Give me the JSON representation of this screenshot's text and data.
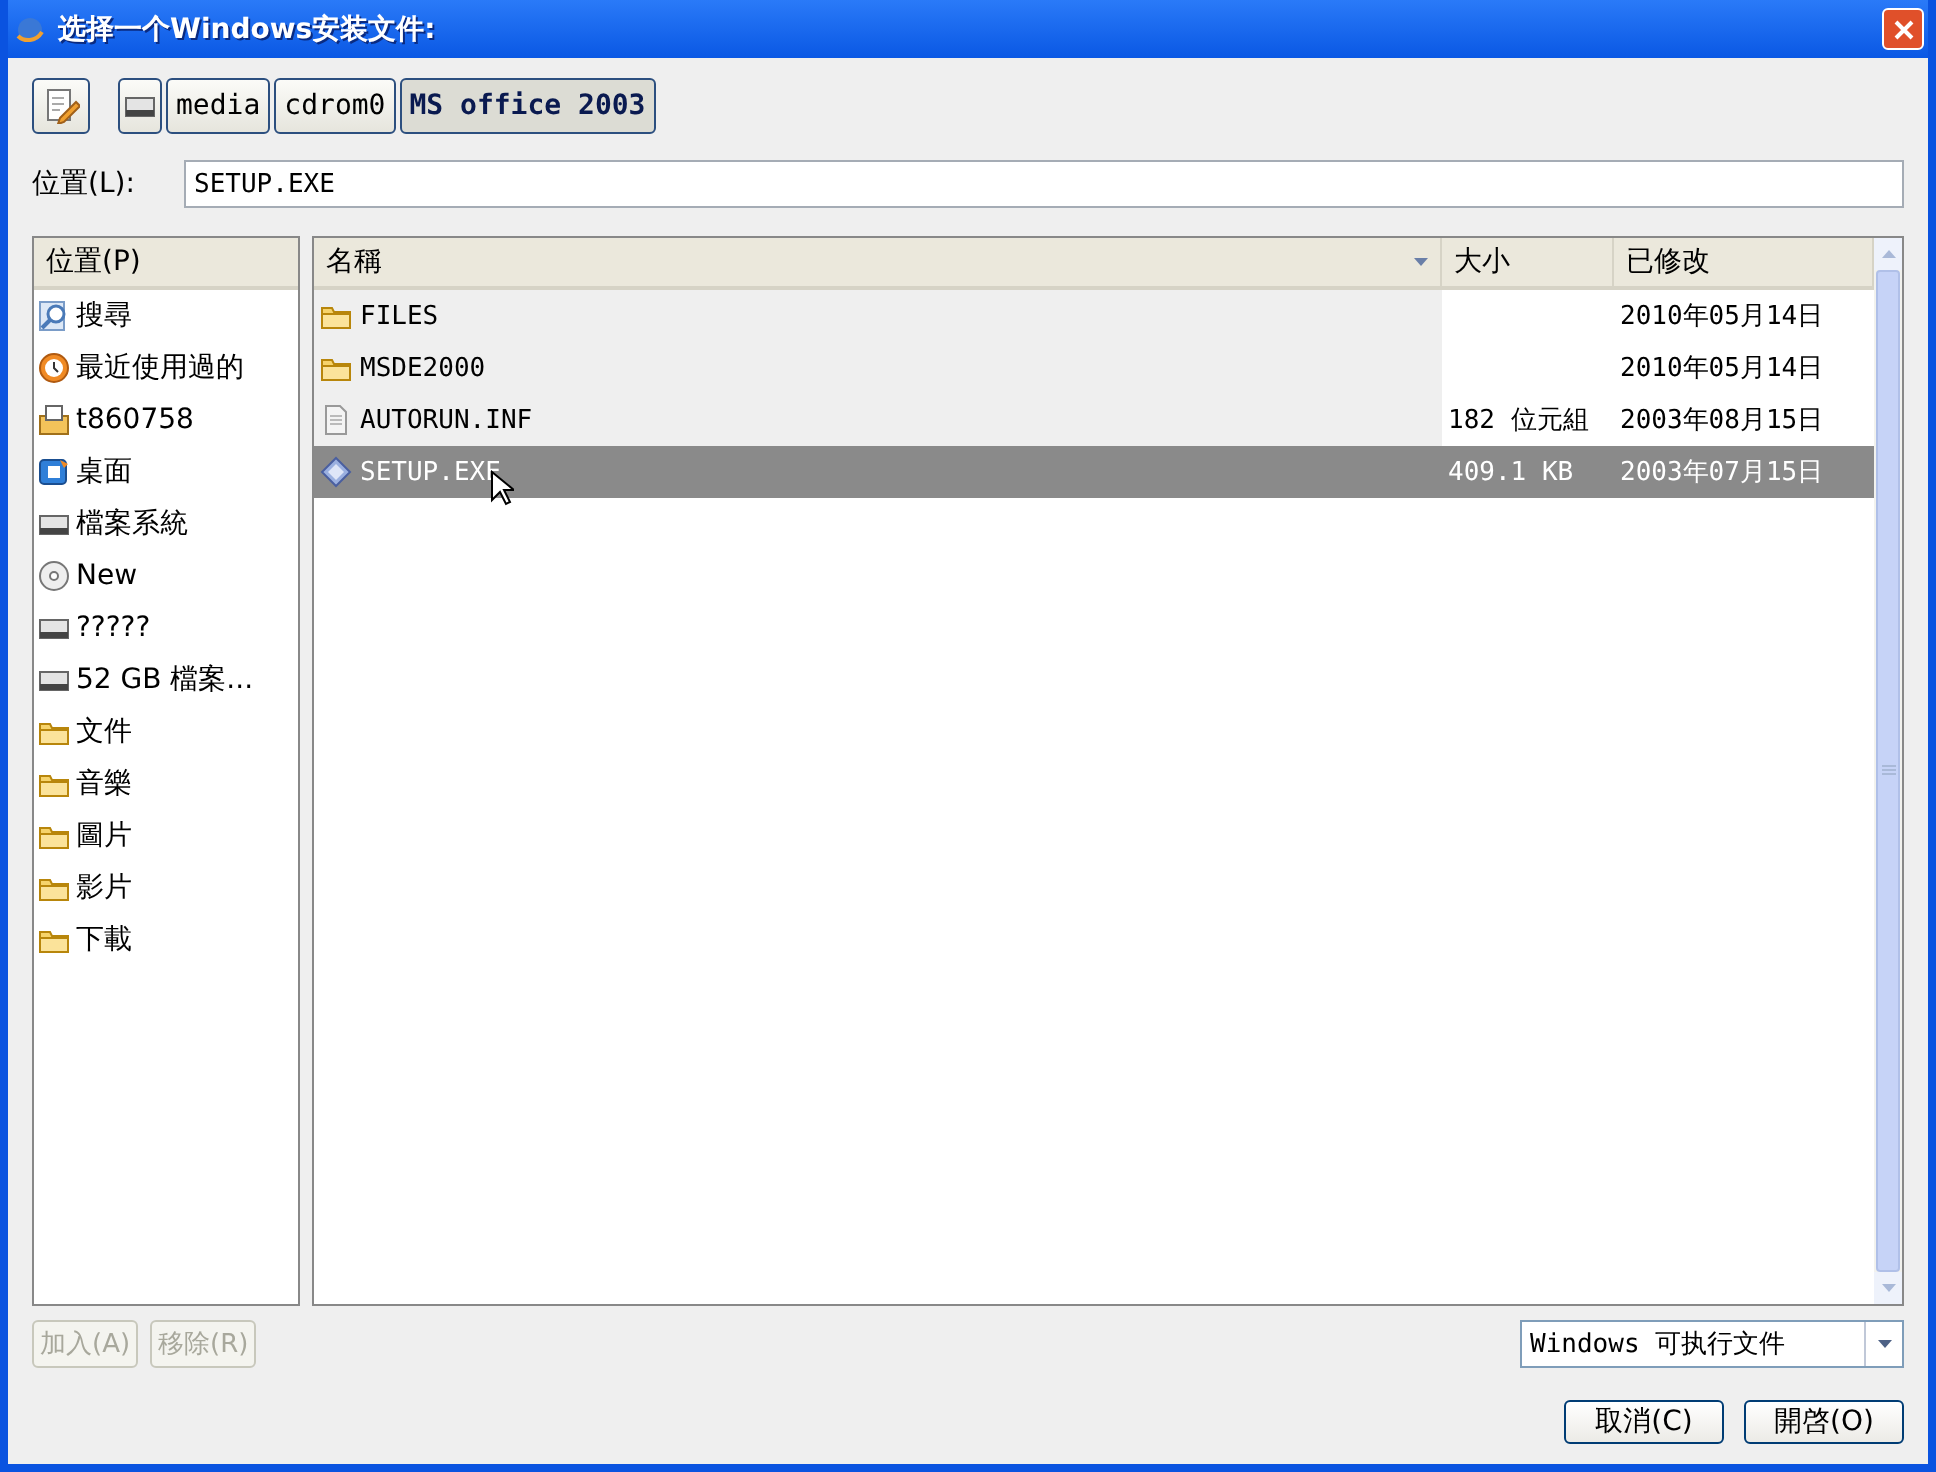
{
  "window": {
    "title": "选择一个Windows安装文件:"
  },
  "path_bar": {
    "buttons": [
      {
        "label": "media",
        "selected": false
      },
      {
        "label": "cdrom0",
        "selected": false
      },
      {
        "label": "MS office 2003",
        "selected": true
      }
    ]
  },
  "location": {
    "label": "位置(L):",
    "value": "SETUP.EXE"
  },
  "places": {
    "heading": "位置(P)",
    "items": [
      {
        "kind": "search",
        "label": "搜尋"
      },
      {
        "kind": "recent",
        "label": "最近使用過的"
      },
      {
        "kind": "home",
        "label": "t860758"
      },
      {
        "kind": "desktop",
        "label": "桌面"
      },
      {
        "kind": "drive",
        "label": "檔案系統"
      },
      {
        "kind": "cdrom",
        "label": "New"
      },
      {
        "kind": "drive",
        "label": "?????"
      },
      {
        "kind": "drive",
        "label": "52 GB 檔案..."
      },
      {
        "kind": "folder",
        "label": "文件"
      },
      {
        "kind": "folder",
        "label": "音樂"
      },
      {
        "kind": "folder",
        "label": "圖片"
      },
      {
        "kind": "folder",
        "label": "影片"
      },
      {
        "kind": "folder",
        "label": "下載"
      }
    ],
    "buttons": [
      {
        "label": "加入(A)",
        "disabled": true
      },
      {
        "label": "移除(R)",
        "disabled": true
      }
    ]
  },
  "files": {
    "columns": [
      "名稱",
      "大小",
      "已修改"
    ],
    "rows": [
      {
        "kind": "folder",
        "name": "FILES",
        "size": "",
        "modified": "2010年05月14日",
        "selected": false
      },
      {
        "kind": "folder",
        "name": "MSDE2000",
        "size": "",
        "modified": "2010年05月14日",
        "selected": false
      },
      {
        "kind": "file",
        "name": "AUTORUN.INF",
        "size": "182 位元組",
        "modified": "2003年08月15日",
        "selected": false
      },
      {
        "kind": "exe",
        "name": "SETUP.EXE",
        "size": "409.1 KB",
        "modified": "2003年07月15日",
        "selected": true
      }
    ]
  },
  "filter": {
    "value": "Windows 可执行文件"
  },
  "buttons": [
    {
      "label": "取消(C)"
    },
    {
      "label": "開啓(O)"
    }
  ]
}
